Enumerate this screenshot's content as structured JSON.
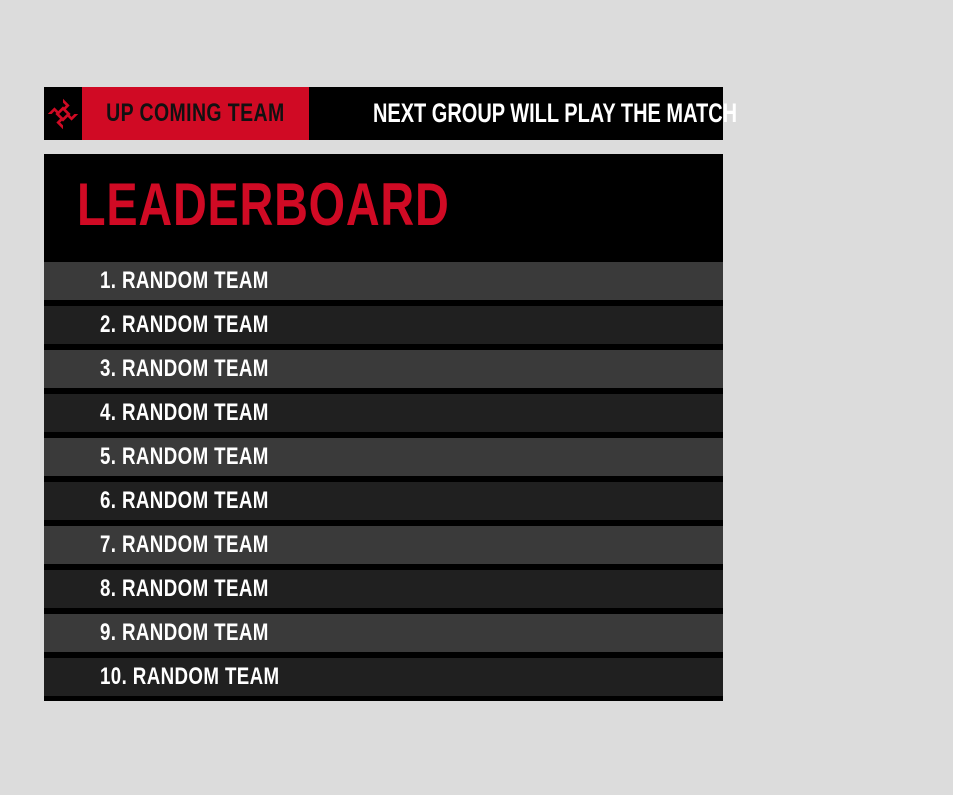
{
  "banner": {
    "upcoming_label": "UP COMING TEAM",
    "next_group_label": "NEXT GROUP WILL PLAY THE MATCH",
    "logo_icon": "spiral-logo-icon"
  },
  "leaderboard": {
    "title": "LEADERBOARD",
    "rows": [
      {
        "text": "1. RANDOM  TEAM"
      },
      {
        "text": "2. RANDOM  TEAM"
      },
      {
        "text": "3. RANDOM  TEAM"
      },
      {
        "text": "4. RANDOM  TEAM"
      },
      {
        "text": "5. RANDOM  TEAM"
      },
      {
        "text": "6. RANDOM  TEAM"
      },
      {
        "text": "7. RANDOM  TEAM"
      },
      {
        "text": "8. RANDOM  TEAM"
      },
      {
        "text": "9. RANDOM  TEAM"
      },
      {
        "text": "10. RANDOM  TEAM"
      }
    ]
  },
  "colors": {
    "accent": "#d00a24",
    "background": "#dcdcdc",
    "panel": "#000000",
    "row_light": "#3a3a3a",
    "row_dark": "#202020"
  }
}
